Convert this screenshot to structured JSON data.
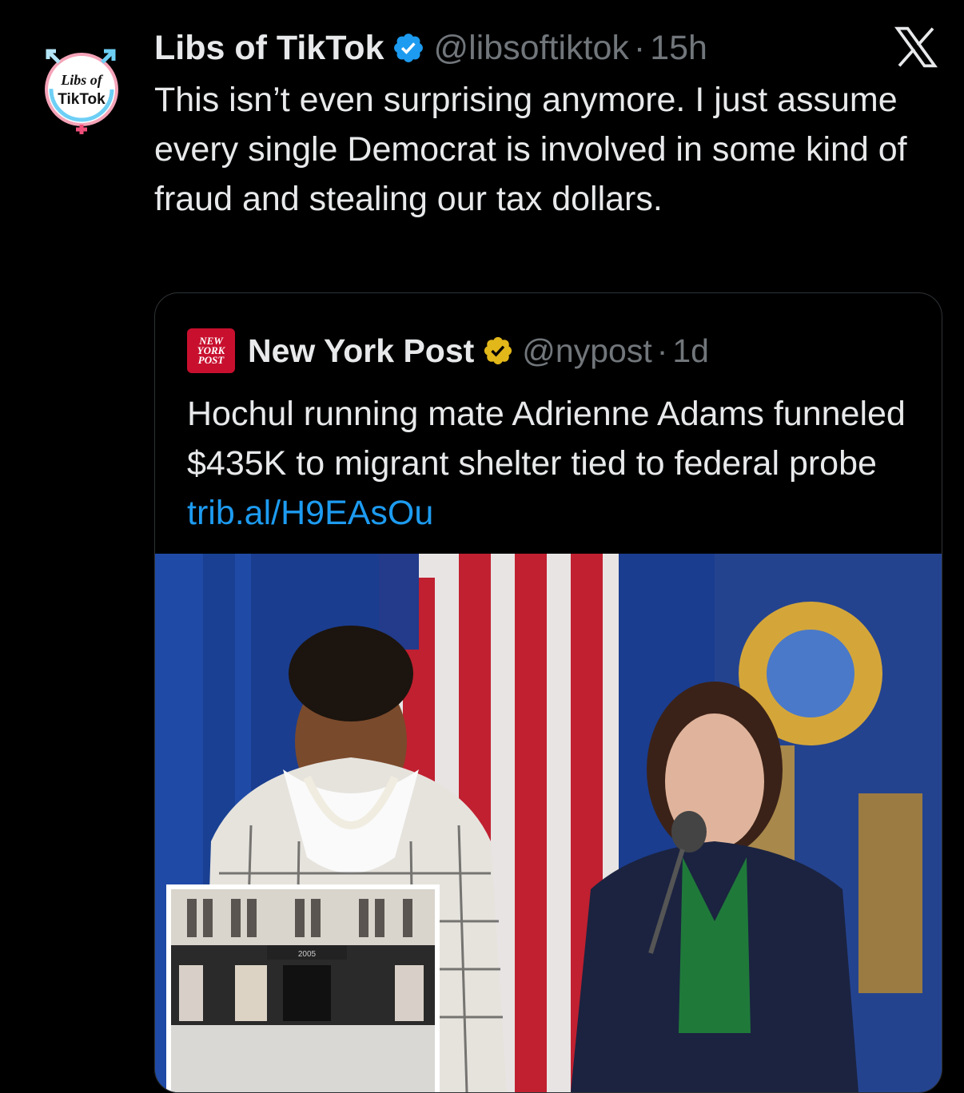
{
  "tweet": {
    "author_name": "Libs of TikTok",
    "handle": "@libsoftiktok",
    "separator": "·",
    "time": "15h",
    "avatar_text_line1": "Libs of",
    "avatar_text_line2": "TikTok",
    "text": "This isn’t even surprising anymore. I just assume every single Democrat is involved in some kind of fraud and stealing our tax dollars."
  },
  "quoted_tweet": {
    "logo_line1": "NEW",
    "logo_line2": "YORK",
    "logo_line3": "POST",
    "author_name": "New York Post",
    "handle": "@nypost",
    "separator": "·",
    "time": "1d",
    "text": "Hochul running mate Adrienne Adams funneled $435K to migrant shelter tied to federal probe ",
    "link": "trib.al/H9EAsOu",
    "image_inset_number": "2005"
  },
  "colors": {
    "background": "#000000",
    "primary_text": "#e7e9ea",
    "secondary_text": "#71767b",
    "link": "#1d9bf0",
    "verified_blue": "#1d9bf0",
    "verified_gold": "#e2b719",
    "nypost_red": "#c8102e"
  },
  "icons": [
    "verified-badge-icon",
    "gold-verified-badge-icon",
    "x-logo-icon",
    "gender-symbol-icon"
  ]
}
